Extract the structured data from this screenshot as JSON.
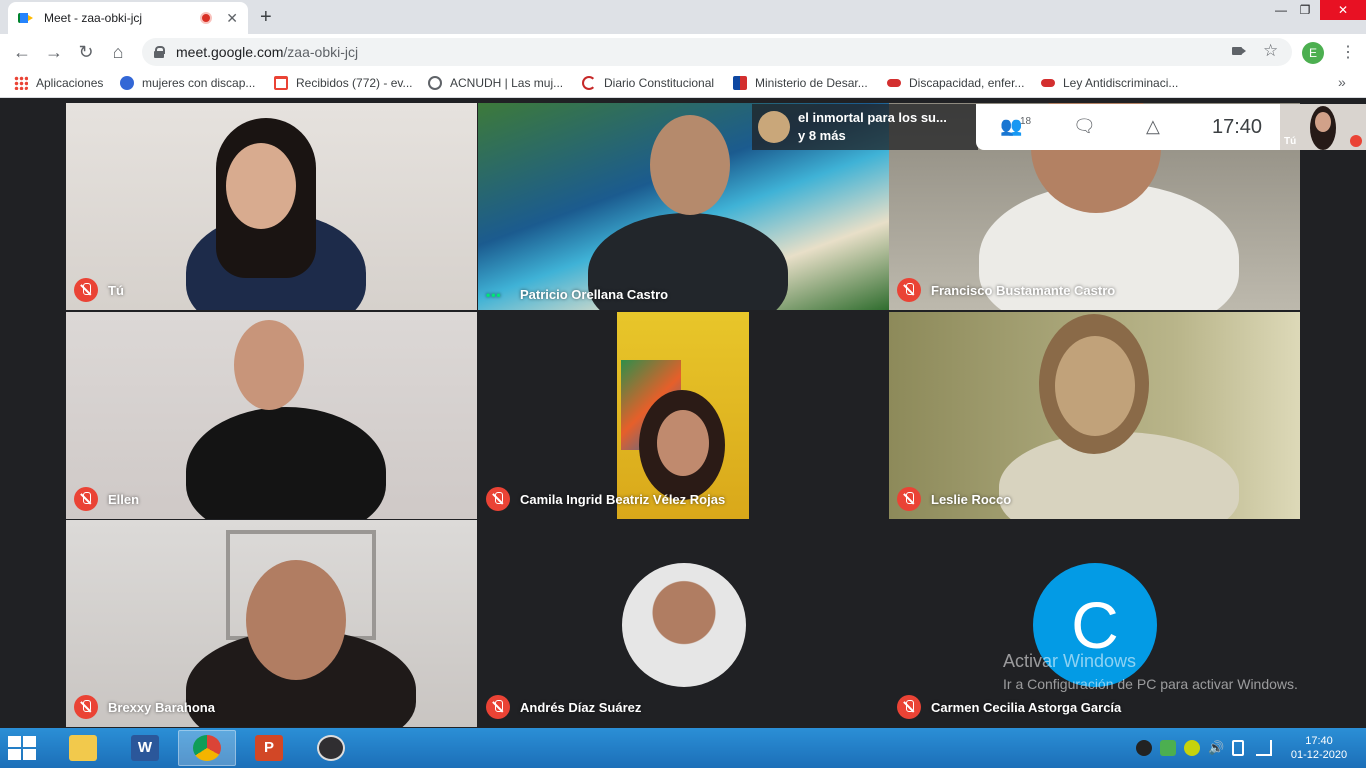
{
  "browser": {
    "tab_title": "Meet - zaa-obki-jcj",
    "new_tab": "+",
    "url_host": "meet.google.com",
    "url_path": "/zaa-obki-jcj",
    "profile_initial": "E",
    "window_controls": [
      "—",
      "❐",
      "✕"
    ]
  },
  "bookmarks": [
    {
      "label": "Aplicaciones",
      "icon": "apps-grid-icon"
    },
    {
      "label": "mujeres con discap...",
      "icon": "chrome-icon"
    },
    {
      "label": "Recibidos (772) - ev...",
      "icon": "gmail-icon"
    },
    {
      "label": "ACNUDH | Las muj...",
      "icon": "globe-icon"
    },
    {
      "label": "Diario Constitucional",
      "icon": "c-logo-icon"
    },
    {
      "label": "Ministerio de Desar...",
      "icon": "flag-icon"
    },
    {
      "label": "Discapacidad, enfer...",
      "icon": "red-bookmark-icon"
    },
    {
      "label": "Ley Antidiscriminaci...",
      "icon": "red-bookmark-icon"
    }
  ],
  "meet": {
    "notification": {
      "line1": "el inmortal para los su...",
      "line2": "y 8 más"
    },
    "participants_count": "18",
    "clock": "17:40",
    "self_label": "Tú",
    "participants": [
      {
        "name": "Tú",
        "status": "muted"
      },
      {
        "name": "Patricio Orellana Castro",
        "status": "speaking"
      },
      {
        "name": "Francisco Bustamante Castro",
        "status": "muted"
      },
      {
        "name": "Ellen",
        "status": "muted"
      },
      {
        "name": "Camila Ingrid Beatriz Vélez Rojas",
        "status": "muted"
      },
      {
        "name": "Leslie Rocco",
        "status": "muted"
      },
      {
        "name": "Brexxy Barahona",
        "status": "muted"
      },
      {
        "name": "Andrés Díaz Suárez",
        "status": "muted"
      },
      {
        "name": "Carmen Cecilia Astorga García",
        "status": "muted",
        "avatar_letter": "C",
        "avatar_color": "#039be5"
      }
    ]
  },
  "watermark": {
    "line1": "Activar Windows",
    "line2": "Ir a Configuración de PC para activar Windows."
  },
  "taskbar": {
    "time": "17:40",
    "date": "01-12-2020",
    "apps": [
      {
        "name": "file-explorer",
        "label": ""
      },
      {
        "name": "word",
        "label": "W"
      },
      {
        "name": "chrome",
        "label": ""
      },
      {
        "name": "powerpoint",
        "label": "P"
      },
      {
        "name": "obs",
        "label": ""
      }
    ]
  }
}
